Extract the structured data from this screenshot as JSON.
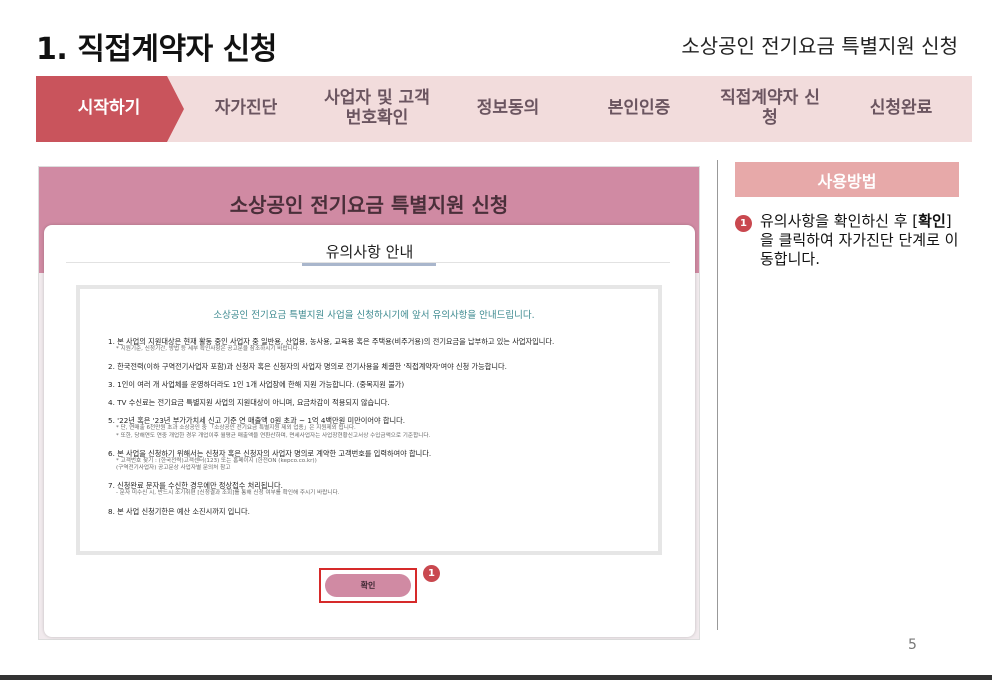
{
  "header": {
    "title": "1. 직접계약자 신청",
    "subtitle": "소상공인 전기요금 특별지원 신청"
  },
  "steps": [
    {
      "label": "시작하기",
      "state": "active"
    },
    {
      "label": "자가진단",
      "state": "inactive"
    },
    {
      "label": "사업자 및 고객번호확인",
      "state": "inactive"
    },
    {
      "label": "정보동의",
      "state": "inactive"
    },
    {
      "label": "본인인증",
      "state": "inactive"
    },
    {
      "label": "직접계약자 신청",
      "state": "inactive"
    },
    {
      "label": "신청완료",
      "state": "inactive"
    }
  ],
  "screenshot": {
    "title": "소상공인 전기요금 특별지원 신청",
    "panel_heading": "유의사항 안내",
    "intro": "소상공인 전기요금 특별지원 사업을 신청하시기에 앞서 유의사항을 안내드립니다.",
    "items": [
      {
        "text": "1. 본 사업의 지원대상은 현재 활동 중인 사업자 중 일반용, 산업용, 농사용, 교육용 혹은 주택용(비주거용)의 전기요금을 납부하고 있는 사업자입니다.",
        "sub": [
          "* 지원기준, 신청기간, 방법 등 세부 확인사항은 공고문을 참조하시기 바랍니다."
        ]
      },
      {
        "text": "2. 한국전력(이하 구역전기사업자 포함)과 신청자 혹은 신청자의 사업자 명의로 전기사용을 체결한 '직접계약자'여야 신청 가능합니다.",
        "sub": []
      },
      {
        "text": "3. 1인이 여러 개 사업체를 운영하더라도 1인 1개 사업장에 한해 지원 가능합니다. (중복지원 불가)",
        "sub": []
      },
      {
        "text": "4. TV 수신료는 전기요금 특별지원 사업의 지원대상이 아니며, 요금차감이 적용되지 않습니다.",
        "sub": []
      },
      {
        "text": "5. '22년 혹은 '23년 부가가치세 신고 기준 연 매출액 0원 초과 ~ 1억 4백만원 미만이어야 합니다.",
        "sub": [
          "* 단, 연매출 6천만원 초과 소상공인 중 「소상공인 전기요금 특별지원 제외 업종」은 지원제외 됩니다.",
          "* 또한, 당해연도 연중 개업한 경우 개업이후 월평균 매출액을 연환산하며, 면세사업자는 사업장현황신고서상 수입금액으로 기준합니다."
        ]
      },
      {
        "text": "6. 본 사업을 신청하기 위해서는 신청자 혹은 신청자의 사업자 명의로 계약한 고객번호를 입력하여야 합니다.",
        "sub": [
          "* 고객번호 찾기 : (한국전력)고객센터(123) 또는 홈페이지 (한전ON (kepco.co.kr))",
          "(구역전기사업자) 공고문상 사업자별 문의처 참고"
        ]
      },
      {
        "text": "7. 신청완료 문자를 수신한 경우에만 정상접수 처리됩니다.",
        "sub": [
          "- 문자 미수신 시, 반드시 조기취편 [신청결과 조회]를 통해 신청 여부를 확인해 주시기 바랍니다."
        ]
      },
      {
        "text": "8. 본 사업 신청기한은 예산 소진시까지 입니다.",
        "sub": []
      }
    ],
    "confirm_label": "확인",
    "badge": "1"
  },
  "usage": {
    "header": "사용방법",
    "badge": "1",
    "text_before": "유의사항을 확인하신 후 [",
    "text_bold": "확인",
    "text_after": "]을 클릭하여 자가진단 단계로 이동합니다."
  },
  "page_number": "5",
  "colors": {
    "active_step": "#c9545c",
    "inactive_step": "#f2dcdc",
    "header_band": "#d08aa3",
    "usage_header": "#e7a9a9",
    "badge": "#c9484f",
    "highlight_box": "#d62a2a"
  }
}
